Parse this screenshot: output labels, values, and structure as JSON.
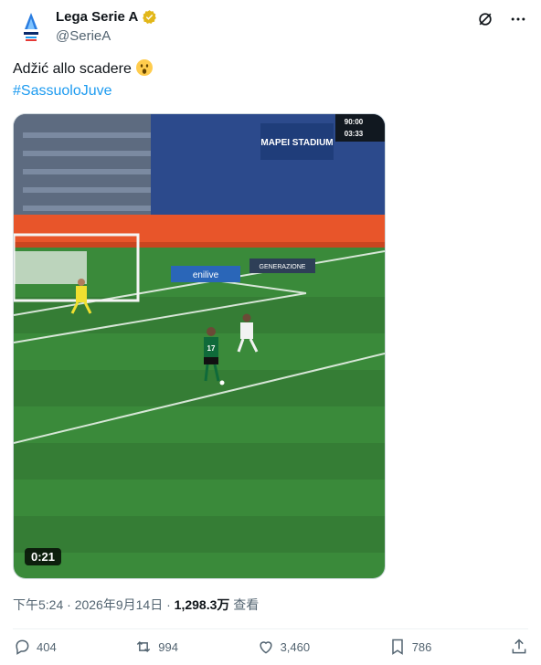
{
  "author": {
    "name": "Lega Serie A",
    "handle": "@SerieA",
    "logo_label": "SERIE A"
  },
  "tweet": {
    "text": "Adžić allo scadere",
    "hashtag": "#SassuoloJuve",
    "emoji": "astonished-face"
  },
  "media": {
    "duration": "0:21",
    "scoreboard_time": "90:00",
    "scoreboard_added": "03:33",
    "stadium_sign": "MAPEI STADIUM",
    "ad_board_1": "enilive",
    "ad_board_2": "GENERAZIONE",
    "player_number": "17"
  },
  "meta": {
    "time": "下午5:24",
    "sep1": "·",
    "date": "2026年9月14日",
    "sep2": "·",
    "views_count": "1,298.3万",
    "views_label": "查看"
  },
  "actions": {
    "replies": "404",
    "reposts": "994",
    "likes": "3,460",
    "bookmarks": "786"
  },
  "colors": {
    "accent": "#1d9bf0",
    "verified": "#e2b719",
    "pitch": "#3a8a3a"
  }
}
